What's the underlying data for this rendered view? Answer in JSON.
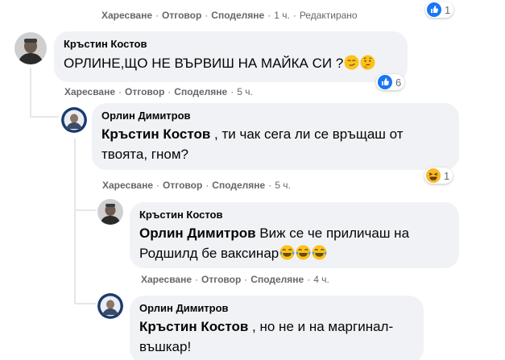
{
  "top_comment": {
    "actions": [
      "Харесване",
      "Отговор",
      "Споделяне"
    ],
    "time": "1 ч.",
    "edited": "Редактирано",
    "reaction_icon": "like-icon",
    "reaction_count": "1"
  },
  "comments": [
    {
      "author": "Кръстин Костов",
      "text": "ОРЛИНЕ,ЩО НЕ ВЪРВИШ НА МАЙКА СИ ?",
      "emojis": [
        "smirk-emoji",
        "thinking-emoji"
      ],
      "actions": [
        "Харесване",
        "Отговор",
        "Споделяне"
      ],
      "time": "5 ч.",
      "reaction_icon": "like-icon",
      "reaction_count": "6"
    },
    {
      "author": "Орлин Димитров",
      "mention": "Кръстин Костов",
      "text_line1": ", ти чак сега ли се връщаш от",
      "text_line2": "твоята, гном?",
      "actions": [
        "Харесване",
        "Отговор",
        "Споделяне"
      ],
      "time": "5 ч.",
      "reaction_icon": "haha-icon",
      "reaction_count": "1"
    },
    {
      "author": "Кръстин Костов",
      "mention": "Орлин Димитров",
      "text_line1": "Виж се че приличаш на",
      "text_line2": "Родшилд бе ваксинар",
      "emojis": [
        "tears-of-joy-emoji",
        "tears-of-joy-emoji",
        "tears-of-joy-emoji"
      ],
      "actions": [
        "Харесване",
        "Отговор",
        "Споделяне"
      ],
      "time": "4 ч."
    },
    {
      "author": "Орлин Димитров",
      "mention": "Кръстин Костов",
      "text_line1": ", но не и на маргинал-",
      "text_line2": "въшкар!"
    }
  ],
  "colors": {
    "bubble": "#f0f2f5",
    "meta_text": "#65676b",
    "like_blue": "#1877f2",
    "haha_yellow": "#f7b928"
  }
}
